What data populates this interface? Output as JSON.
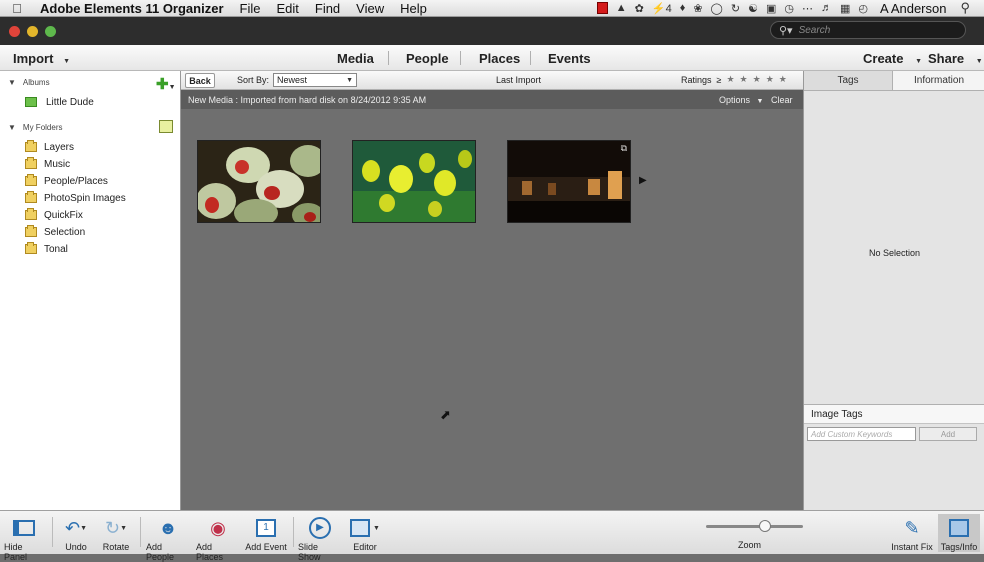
{
  "menubar": {
    "app_name": "Adobe Elements 11 Organizer",
    "items": [
      "File",
      "Edit",
      "Find",
      "View",
      "Help"
    ],
    "battery_number": "4",
    "user": "A Anderson"
  },
  "search": {
    "placeholder": "Search"
  },
  "nav": {
    "import_label": "Import",
    "tabs": [
      "Media",
      "People",
      "Places",
      "Events"
    ],
    "create_label": "Create",
    "share_label": "Share"
  },
  "left_panel": {
    "albums_header": "Albums",
    "albums": [
      "Little Dude"
    ],
    "folders_header": "My Folders",
    "folders": [
      "Layers",
      "Music",
      "People/Places",
      "PhotoSpin Images",
      "QuickFix",
      "Selection",
      "Tonal"
    ]
  },
  "toolstrip": {
    "back_label": "Back",
    "sort_by_label": "Sort By:",
    "sort_value": "Newest",
    "view_title": "Last Import",
    "ratings_label": "Ratings",
    "ratings_operator": "≥"
  },
  "info_bar": {
    "text": "New Media : Imported from hard disk on 8/24/2012 9:35 AM",
    "options_label": "Options",
    "clear_label": "Clear"
  },
  "right_panel": {
    "tabs": [
      "Tags",
      "Information"
    ],
    "no_selection": "No Selection",
    "image_tags_header": "Image Tags",
    "keyword_placeholder": "Add Custom Keywords",
    "add_label": "Add"
  },
  "bottom_bar": {
    "hide_panel": "Hide Panel",
    "undo": "Undo",
    "rotate": "Rotate",
    "add_people": "Add People",
    "add_places": "Add Places",
    "add_event": "Add Event",
    "slide_show": "Slide Show",
    "editor": "Editor",
    "zoom": "Zoom",
    "instant_fix": "Instant Fix",
    "tags_info": "Tags/Info"
  },
  "colors": {
    "accent": "#2a6fb0",
    "dark_chrome": "#2d2d2d",
    "grid_bg": "#6f6f6f"
  }
}
